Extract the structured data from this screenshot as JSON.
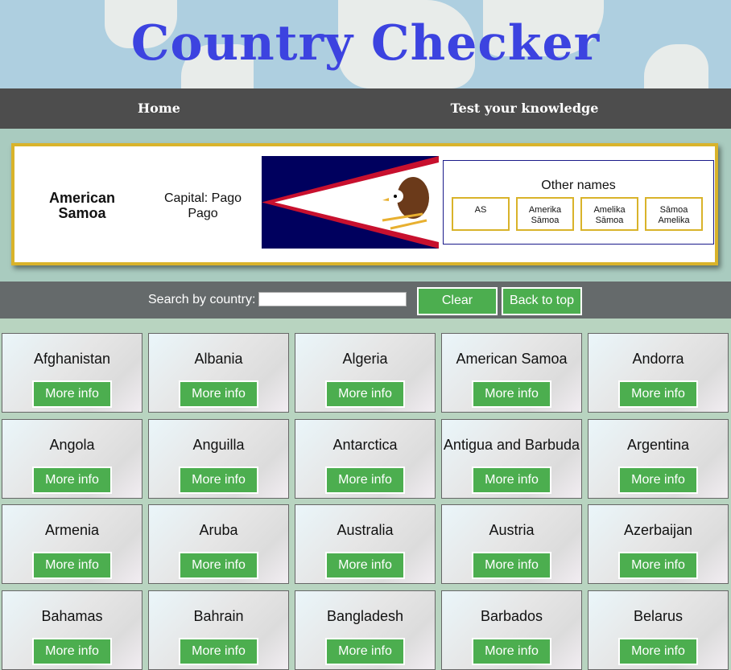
{
  "header": {
    "title": "Country Checker"
  },
  "nav": {
    "home": "Home",
    "test": "Test your knowledge"
  },
  "selected": {
    "name": "American Samoa",
    "capital": "Capital: Pago Pago",
    "other_names_title": "Other names",
    "other_names": [
      "AS",
      "Amerika Sāmoa",
      "Amelika Sāmoa",
      "Sāmoa Amelika"
    ],
    "flag_colors": {
      "blue": "#00005e",
      "red": "#c8102e",
      "white": "#ffffff",
      "eagle": "#6b3a1a"
    }
  },
  "search": {
    "label": "Search by country:",
    "placeholder": "",
    "clear": "Clear",
    "back_to_top": "Back to top"
  },
  "countries": [
    "Afghanistan",
    "Albania",
    "Algeria",
    "American Samoa",
    "Andorra",
    "Angola",
    "Anguilla",
    "Antarctica",
    "Antigua and Barbuda",
    "Argentina",
    "Armenia",
    "Aruba",
    "Australia",
    "Austria",
    "Azerbaijan",
    "Bahamas",
    "Bahrain",
    "Bangladesh",
    "Barbados",
    "Belarus"
  ],
  "more_info_label": "More info",
  "colors": {
    "title": "#3c43e0",
    "nav": "#4d4d4d",
    "accent_border": "#d9b32a",
    "button": "#4cae4f",
    "search_bar": "#656a6b"
  }
}
